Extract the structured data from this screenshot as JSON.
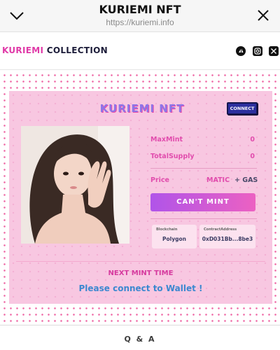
{
  "browser": {
    "title": "KURIEMI NFT",
    "url": "https://kuriemi.info"
  },
  "header": {
    "logo_part1": "KURIEMI",
    "logo_part2": " COLLECTION",
    "social_icons": [
      "opensea-icon",
      "instagram-icon",
      "x-icon"
    ]
  },
  "card": {
    "title": "KURIEMI NFT",
    "connect_label": "CONNECT",
    "max_mint_label": "MaxMint",
    "max_mint_value": "0",
    "total_supply_label": "TotalSupply",
    "total_supply_value": "0",
    "price_label": "Price",
    "price_currency": "MATIC",
    "price_gas": "+ GAS",
    "mint_button": "CAN'T MINT",
    "blockchain_label": "Blockchain",
    "blockchain_value": "Polygon",
    "contract_label": "ContractAddress",
    "contract_value": "0xD031Bb...8be3",
    "next_mint_label": "NEXT MINT TIME",
    "wallet_message": "Please connect to Wallet !"
  },
  "footer": {
    "qa_label": "Q & A"
  },
  "colors": {
    "card_bg": "#f8c7e1",
    "accent_pink": "#e14cad",
    "button_gradient_start": "#b054e9",
    "button_gradient_end": "#ec61c2",
    "connect_button": "#2c2f9e",
    "wallet_text": "#3c88d0"
  }
}
